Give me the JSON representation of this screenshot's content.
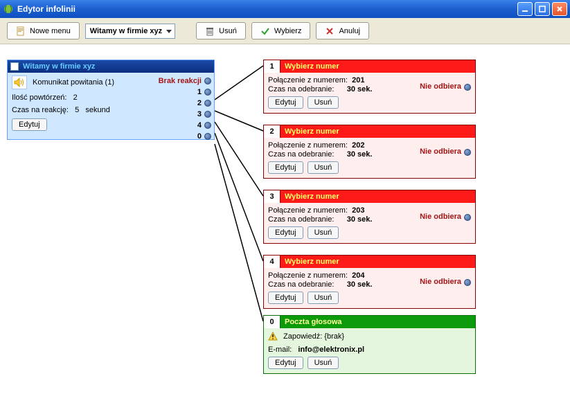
{
  "window": {
    "title": "Edytor infolinii"
  },
  "toolbar": {
    "new_menu": "Nowe menu",
    "dropdown_selected": "Witamy w firmie xyz",
    "delete": "Usuń",
    "select": "Wybierz",
    "cancel": "Anuluj"
  },
  "source": {
    "title": "Witamy w firmie xyz",
    "greeting_label": "Komunikat powitania (1)",
    "no_reaction": "Brak reakcji",
    "repeat_label": "Ilość powtórzeń:",
    "repeat_value": "2",
    "reaction_label": "Czas na reakcję:",
    "reaction_value": "5",
    "reaction_unit": "sekund",
    "edit": "Edytuj",
    "ports": [
      "1",
      "2",
      "3",
      "4",
      "0"
    ]
  },
  "cards": [
    {
      "num": "1",
      "title": "Wybierz numer",
      "conn_label": "Połączenie z numerem:",
      "conn_value": "201",
      "time_label": "Czas na odebranie:",
      "time_value": "30 sek.",
      "status": "Nie odbiera",
      "edit": "Edytuj",
      "delete": "Usuń"
    },
    {
      "num": "2",
      "title": "Wybierz numer",
      "conn_label": "Połączenie z numerem:",
      "conn_value": "202",
      "time_label": "Czas na odebranie:",
      "time_value": "30 sek.",
      "status": "Nie odbiera",
      "edit": "Edytuj",
      "delete": "Usuń"
    },
    {
      "num": "3",
      "title": "Wybierz numer",
      "conn_label": "Połączenie z numerem:",
      "conn_value": "203",
      "time_label": "Czas na odebranie:",
      "time_value": "30 sek.",
      "status": "Nie odbiera",
      "edit": "Edytuj",
      "delete": "Usuń"
    },
    {
      "num": "4",
      "title": "Wybierz numer",
      "conn_label": "Połączenie z numerem:",
      "conn_value": "204",
      "time_label": "Czas na odebranie:",
      "time_value": "30 sek.",
      "status": "Nie odbiera",
      "edit": "Edytuj",
      "delete": "Usuń"
    }
  ],
  "voicemail": {
    "num": "0",
    "title": "Poczta głosowa",
    "announce_label": "Zapowiedź: {brak}",
    "email_label": "E-mail:",
    "email_value": "info@elektronix.pl",
    "edit": "Edytuj",
    "delete": "Usuń"
  }
}
